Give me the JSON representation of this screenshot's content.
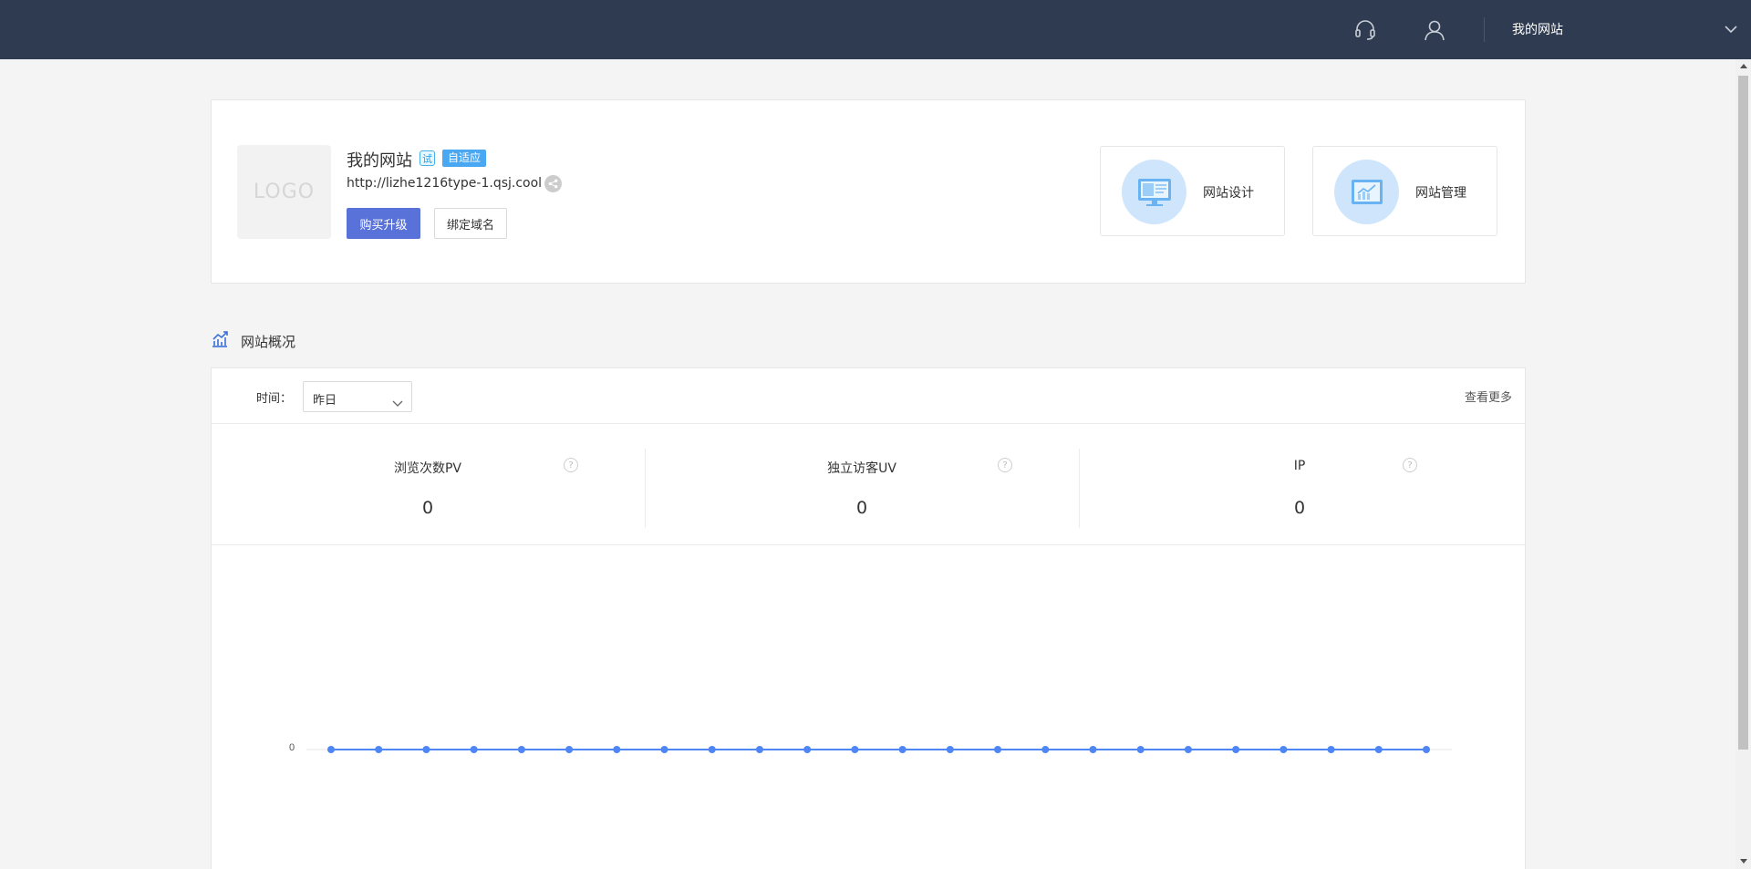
{
  "header": {
    "site_name": "我的网站",
    "icons": [
      "headset-icon",
      "user-icon",
      "chevron-down-icon"
    ]
  },
  "site": {
    "logo_text": "LOGO",
    "title": "我的网站",
    "trial_badge": "试",
    "adaptive_badge": "自适应",
    "url": "http://lizhe1216type-1.qsj.cool",
    "buy_button": "购买升级",
    "bind_button": "绑定域名",
    "quick_links": [
      {
        "label": "网站设计",
        "icon": "monitor-design-icon"
      },
      {
        "label": "网站管理",
        "icon": "chart-manage-icon"
      }
    ]
  },
  "overview": {
    "heading": "网站概况",
    "time_label": "时间：",
    "time_value": "昨日",
    "view_more": "查看更多",
    "metrics": [
      {
        "name": "浏览次数PV",
        "value": "0"
      },
      {
        "name": "独立访客UV",
        "value": "0"
      },
      {
        "name": "IP",
        "value": "0"
      }
    ]
  },
  "colors": {
    "topbar": "#2f3b50",
    "primary": "#5872d9",
    "line": "#4e86f5",
    "badge": "#4aa7f2"
  },
  "chart_data": {
    "type": "line",
    "x": [
      "",
      "",
      "",
      "",
      "",
      "",
      "",
      "",
      "",
      "",
      "",
      "",
      "",
      "",
      "",
      "",
      "",
      "",
      "",
      "",
      "",
      "",
      "",
      ""
    ],
    "series": [
      {
        "values": [
          0,
          0,
          0,
          0,
          0,
          0,
          0,
          0,
          0,
          0,
          0,
          0,
          0,
          0,
          0,
          0,
          0,
          0,
          0,
          0,
          0,
          0,
          0,
          0
        ]
      }
    ],
    "y_ticks": [
      "0"
    ],
    "grid": false,
    "legend": "none"
  }
}
